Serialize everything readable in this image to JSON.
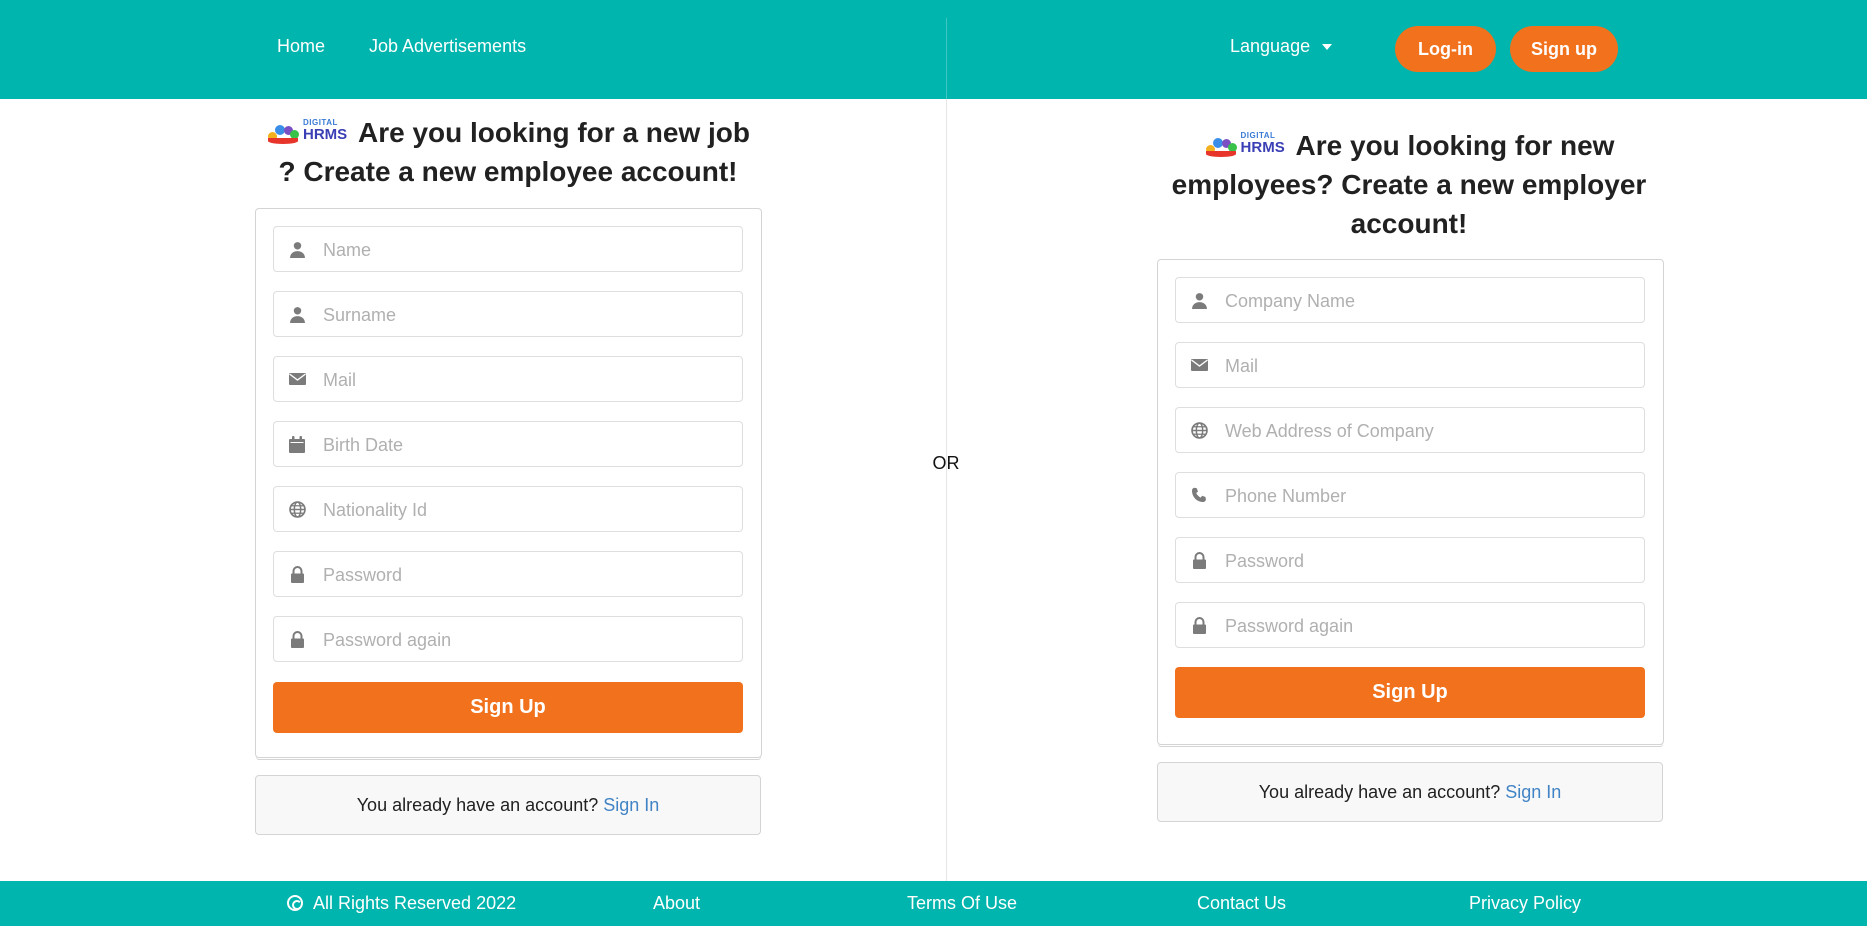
{
  "nav": {
    "home": "Home",
    "jobs": "Job Advertisements",
    "language": "Language",
    "login": "Log-in",
    "signup": "Sign up"
  },
  "brand": {
    "small": "DIGITAL",
    "big": "HRMS"
  },
  "employee": {
    "heading": "Are you looking for a new job ? Create a new employee account!",
    "fields": {
      "name": "Name",
      "surname": "Surname",
      "mail": "Mail",
      "birth_date": "Birth Date",
      "nationality_id": "Nationality Id",
      "password": "Password",
      "password_again": "Password again"
    },
    "submit": "Sign Up",
    "already_text": "You already have an account?",
    "signin": "Sign In"
  },
  "divider": {
    "or": "OR"
  },
  "employer": {
    "heading": "Are you looking for new employees? Create a new employer account!",
    "fields": {
      "company_name": "Company Name",
      "mail": "Mail",
      "web_address": "Web Address of Company",
      "phone": "Phone Number",
      "password": "Password",
      "password_again": "Password again"
    },
    "submit": "Sign Up",
    "already_text": "You already have an account?",
    "signin": "Sign In"
  },
  "footer": {
    "copyright": "All Rights Reserved 2022",
    "about": "About",
    "terms": "Terms Of Use",
    "contact": "Contact Us",
    "privacy": "Privacy Policy"
  },
  "colors": {
    "teal": "#00b5ad",
    "orange": "#f2711c",
    "link": "#4183c4"
  }
}
